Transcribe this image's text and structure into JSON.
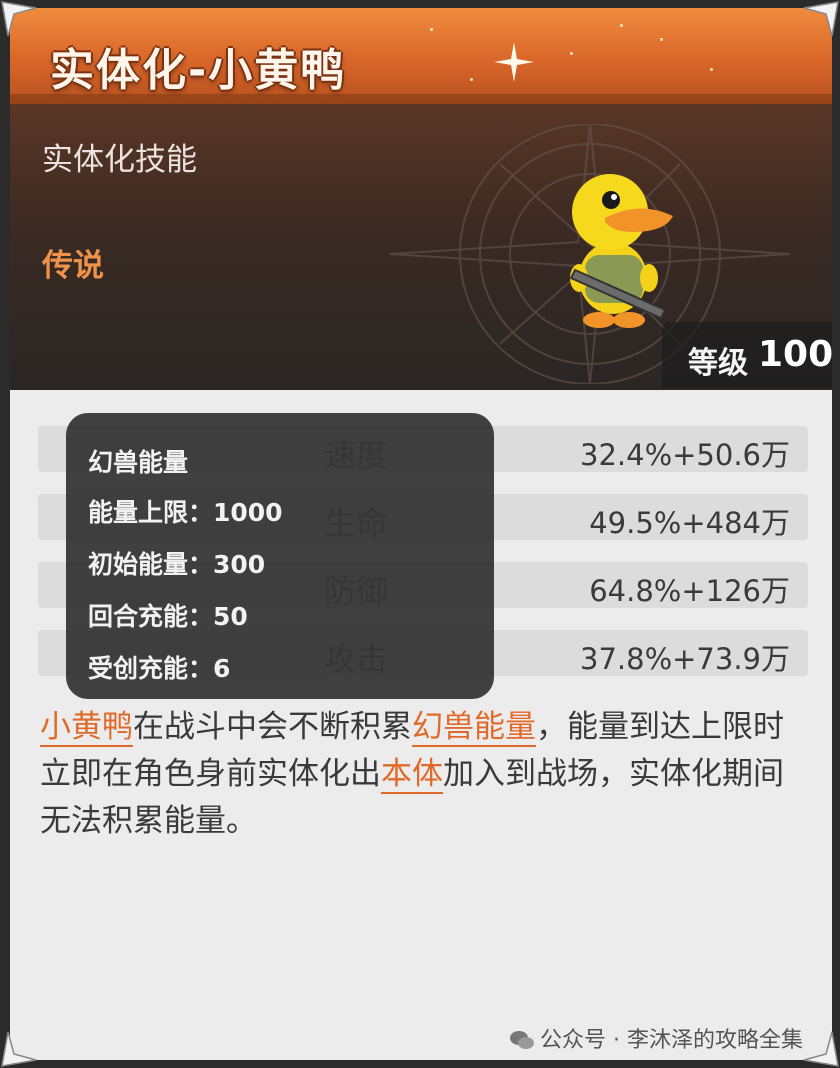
{
  "title": "实体化-小黄鸭",
  "skill_type": "实体化技能",
  "rarity": "传说",
  "level": {
    "label": "等级",
    "value": "100"
  },
  "energy": {
    "title": "幻兽能量",
    "lines": [
      "能量上限：1000",
      "初始能量：300",
      "回合充能：50",
      "受创充能：6"
    ]
  },
  "stats": [
    {
      "label": "速度",
      "value": "32.4%+50.6万"
    },
    {
      "label": "生命",
      "value": "49.5%+484万"
    },
    {
      "label": "防御",
      "value": "64.8%+126万"
    },
    {
      "label": "攻击",
      "value": "37.8%+73.9万"
    }
  ],
  "description": {
    "hl1": "小黄鸭",
    "t1": "在战斗中会不断积累",
    "hl2": "幻兽能量",
    "t2": "，能量到达上限时立即在角色身前实体化出",
    "hl3": "本体",
    "t3": "加入到战场，实体化期间无法积累能量。"
  },
  "watermark": "公众号 · 李沐泽的攻略全集",
  "colors": {
    "header_orange": "#d9662a",
    "rarity_orange": "#f0934a",
    "highlight": "#e06a2a"
  },
  "icons": [
    "duck-character-icon",
    "compass-emblem-icon",
    "sparkle-icon",
    "wechat-icon",
    "corner-ornament-icon"
  ]
}
